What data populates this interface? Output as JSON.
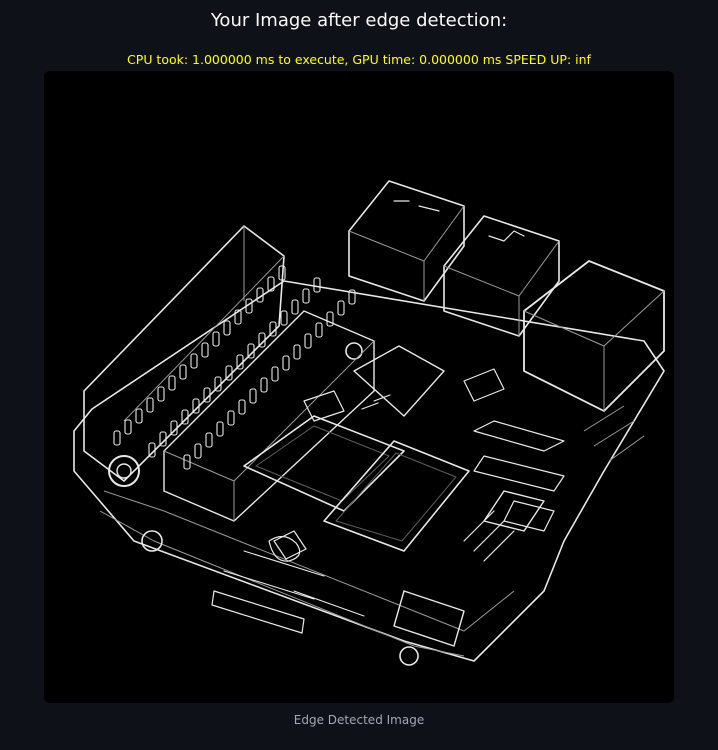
{
  "header": {
    "title": "Your Image after edge detection:",
    "timing": "CPU took: 1.000000 ms to execute, GPU time: 0.000000 ms SPEED UP: inf"
  },
  "image": {
    "caption": "Edge Detected Image",
    "subject": "edge-detected circuit board"
  },
  "colors": {
    "background": "#0e1117",
    "timing_text": "#ffff00",
    "title_text": "#fafafa",
    "caption_text": "#a3a8b4"
  }
}
